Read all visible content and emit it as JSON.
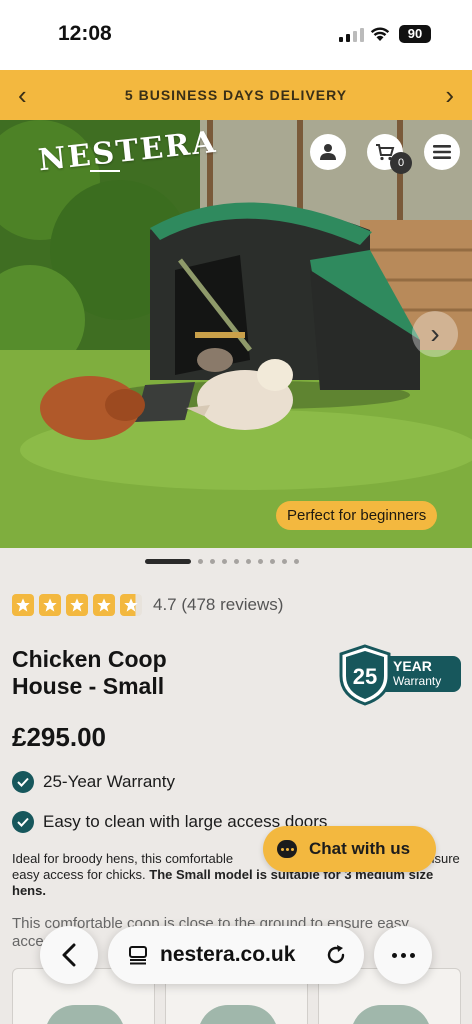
{
  "status_bar": {
    "time": "12:08",
    "battery": "90"
  },
  "banner": {
    "text": "5 BUSINESS DAYS DELIVERY"
  },
  "hero": {
    "logo": "NESTERA",
    "cart_count": "0",
    "pill": "Perfect for beginners",
    "slide_total": 10,
    "slide_active": 1
  },
  "product": {
    "rating_value": 4.7,
    "rating_text": "4.7 (478 reviews)",
    "title_line1": "Chicken Coop",
    "title_line2": "House - Small",
    "warranty_badge": {
      "number": "25",
      "line1": "YEAR",
      "line2": "Warranty"
    },
    "price": "£295.00",
    "features": [
      "25-Year Warranty",
      "Easy to clean with large access doors"
    ],
    "desc_start": "Ideal for broody hens, this comfortable ",
    "desc_hidden_tail": "d to ensure easy access for chicks.",
    "desc_bold": " The Small model is suitable for 3 medium size hens.",
    "desc2": "This comfortable coop is close to the ground to ensure easy access f"
  },
  "chat": {
    "label": "Chat with us"
  },
  "browser": {
    "url": "nestera.co.uk"
  },
  "colors": {
    "accent": "#f3b83f",
    "teal": "#17575c",
    "page_bg": "#ece9e6"
  },
  "icons": [
    "user-icon",
    "cart-icon",
    "menu-icon",
    "chevron-left-icon",
    "chevron-right-icon",
    "check-icon",
    "star-icon",
    "chat-bubble-icon",
    "tabs-icon",
    "reload-icon",
    "more-icon"
  ]
}
